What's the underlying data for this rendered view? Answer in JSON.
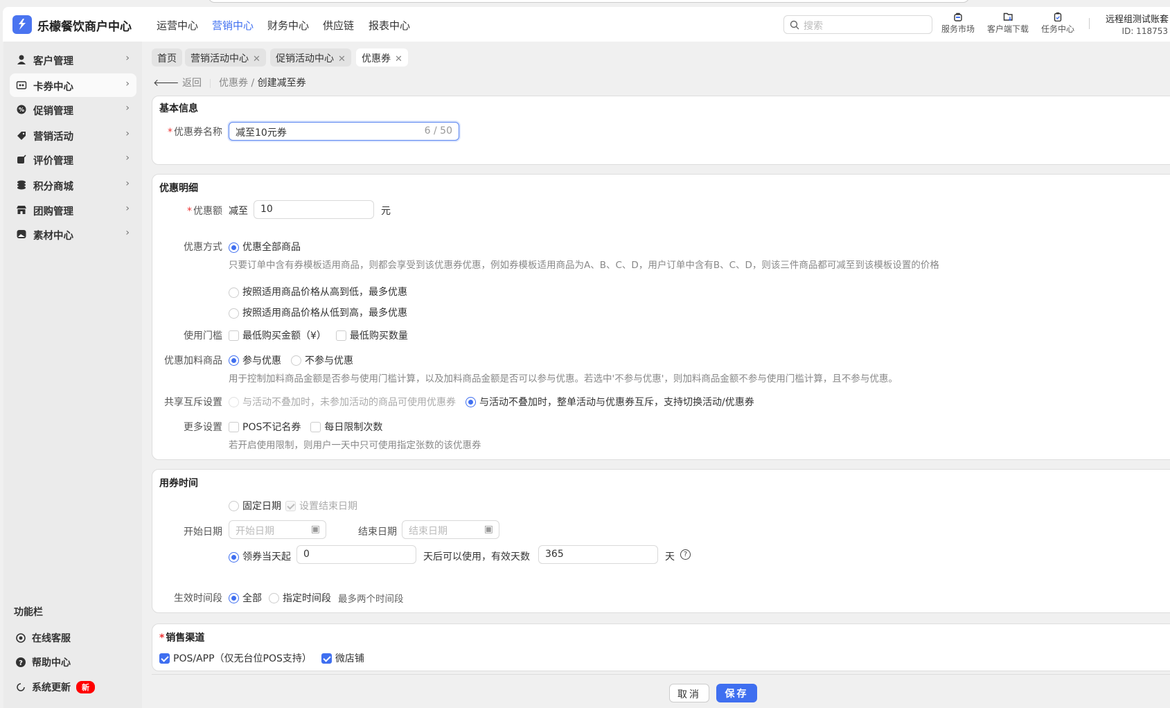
{
  "app": {
    "title": "乐檬餐饮商户中心"
  },
  "nav": [
    "运营中心",
    "营销中心",
    "财务中心",
    "供应链",
    "报表中心"
  ],
  "search": {
    "placeholder": "搜索"
  },
  "tools": [
    "服务市场",
    "客户端下载",
    "任务中心"
  ],
  "account": {
    "name": "远程组测试账套",
    "id": "ID: 118753"
  },
  "sidebar": {
    "items": [
      "客户管理",
      "卡券中心",
      "促销管理",
      "营销活动",
      "评价管理",
      "积分商城",
      "团购管理",
      "素材中心"
    ],
    "func_title": "功能栏",
    "funcs": [
      "在线客服",
      "帮助中心",
      "系统更新"
    ],
    "new_badge": "新"
  },
  "tabs": [
    "首页",
    "营销活动中心",
    "促销活动中心",
    "优惠券"
  ],
  "breadcrumb": {
    "back": "返回",
    "parent": "优惠券",
    "sep": "/",
    "current": "创建减至券"
  },
  "basic": {
    "title": "基本信息",
    "name_label": "优惠券名称",
    "name_value": "减至10元券",
    "counter": "6 / 50"
  },
  "detail": {
    "title": "优惠明细",
    "amount_label": "优惠额",
    "amount_prefix": "减至",
    "amount_value": "10",
    "amount_unit": "元",
    "mode_label": "优惠方式",
    "mode_options": [
      "优惠全部商品",
      "按照适用商品价格从高到低，最多优惠",
      "按照适用商品价格从低到高，最多优惠"
    ],
    "mode_desc": "只要订单中含有券模板适用商品，则都会享受到该优惠券优惠，例如券模板适用商品为A、B、C、D，用户订单中含有B、C、D，则该三件商品都可减至到该模板设置的价格",
    "threshold_label": "使用门槛",
    "threshold_options": [
      "最低购买金额（¥）",
      "最低购买数量"
    ],
    "addon_label": "优惠加料商品",
    "addon_options": [
      "参与优惠",
      "不参与优惠"
    ],
    "addon_desc": "用于控制加料商品金额是否参与使用门槛计算，以及加料商品金额是否可以参与优惠。若选中'不参与优惠'，则加料商品金额不参与使用门槛计算，且不参与优惠。",
    "share_label": "共享互斥设置",
    "share_options": [
      "与活动不叠加时，未参加活动的商品可使用优惠券",
      "与活动不叠加时，整单活动与优惠券互斥，支持切换活动/优惠券"
    ],
    "more_label": "更多设置",
    "more_options": [
      "POS不记名券",
      "每日限制次数"
    ],
    "more_desc": "若开启使用限制，则用户一天中只可使用指定张数的该优惠券"
  },
  "time": {
    "title": "用券时间",
    "fixed": "固定日期",
    "set_end": "设置结束日期",
    "start_label": "开始日期",
    "start_ph": "开始日期",
    "end_label": "结束日期",
    "end_ph": "结束日期",
    "from_day": "领券当天起",
    "from_value": "0",
    "after_text": "天后可以使用，有效天数",
    "valid_value": "365",
    "day_unit": "天",
    "period_label": "生效时间段",
    "period_all": "全部",
    "period_custom": "指定时间段",
    "period_hint": "最多两个时间段"
  },
  "channel": {
    "title": "销售渠道",
    "options": [
      "POS/APP（仅无台位POS支持）",
      "微店铺"
    ]
  },
  "footer": {
    "cancel": "取消",
    "save": "保存"
  },
  "colors": {
    "accent": "#3f6ff0",
    "badge": "#ff0000"
  }
}
